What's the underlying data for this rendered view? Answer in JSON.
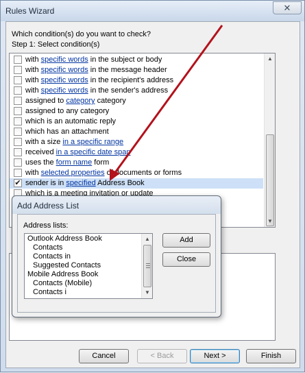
{
  "window": {
    "title": "Rules Wizard",
    "close_glyph": "✕"
  },
  "prompt": "Which condition(s) do you want to check?",
  "step": "Step 1: Select condition(s)",
  "conditions": [
    {
      "checked": false,
      "before": "with ",
      "link": "specific words",
      "after": " in the subject or body"
    },
    {
      "checked": false,
      "before": "with ",
      "link": "specific words",
      "after": " in the message header"
    },
    {
      "checked": false,
      "before": "with ",
      "link": "specific words",
      "after": " in the recipient's address"
    },
    {
      "checked": false,
      "before": "with ",
      "link": "specific words",
      "after": " in the sender's address"
    },
    {
      "checked": false,
      "before": "assigned to ",
      "link": "category",
      "after": " category"
    },
    {
      "checked": false,
      "before": "assigned to any category",
      "link": "",
      "after": ""
    },
    {
      "checked": false,
      "before": "which is an automatic reply",
      "link": "",
      "after": ""
    },
    {
      "checked": false,
      "before": "which has an attachment",
      "link": "",
      "after": ""
    },
    {
      "checked": false,
      "before": "with a size ",
      "link": "in a specific range",
      "after": ""
    },
    {
      "checked": false,
      "before": "received ",
      "link": "in a specific date span",
      "after": ""
    },
    {
      "checked": false,
      "before": "uses the ",
      "link": "form name",
      "after": " form"
    },
    {
      "checked": false,
      "before": "with ",
      "link": "selected properties",
      "after": " of documents or forms"
    },
    {
      "checked": true,
      "before": "sender is in ",
      "link": "specified",
      "after": " Address Book"
    },
    {
      "checked": false,
      "before": "which is a meeting invitation or update",
      "link": "",
      "after": ""
    }
  ],
  "check_glyph": "✔",
  "buttons": {
    "cancel": "Cancel",
    "back": "< Back",
    "next": "Next >",
    "finish": "Finish"
  },
  "dialog": {
    "title": "Add Address List",
    "list_label": "Address lists:",
    "items": [
      {
        "text": "Outlook Address Book",
        "indent": 0
      },
      {
        "text": "Contacts",
        "indent": 1
      },
      {
        "text": "Contacts in",
        "indent": 1
      },
      {
        "text": "Suggested Contacts",
        "indent": 1
      },
      {
        "text": "Mobile Address Book",
        "indent": 0
      },
      {
        "text": "Contacts (Mobile)",
        "indent": 1
      },
      {
        "text": "Contacts in",
        "indent": 1
      }
    ],
    "add": "Add",
    "close": "Close"
  },
  "colors": {
    "link": "#0033a0",
    "annotation_arrow": "#b3121c",
    "selection": "#cde0f7"
  },
  "icons": {
    "scroll_up": "▲",
    "scroll_down": "▼"
  }
}
